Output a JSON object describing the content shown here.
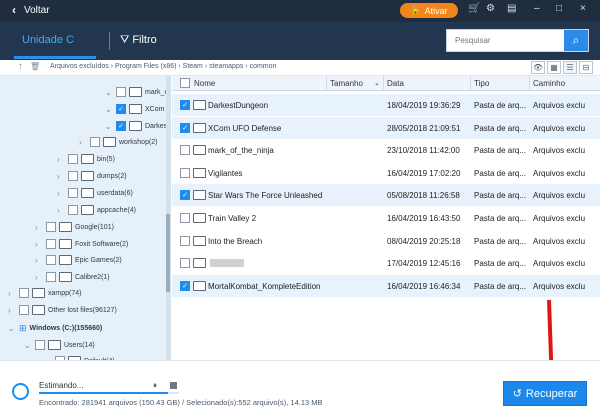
{
  "window": {
    "back_label": "Voltar",
    "activate_label": "Ativar"
  },
  "toolbar": {
    "active_tab": "Unidade C",
    "filter_label": "Filtro",
    "search_placeholder": "Pesquisar"
  },
  "breadcrumb": "Arquivos excluídos  ›  Program Files (x86)  ›  Steam  ›  steamapps  ›  common",
  "tree": [
    {
      "label": "mark_of",
      "checked": false
    },
    {
      "label": "XCom U",
      "checked": true
    },
    {
      "label": "DarkestD",
      "checked": true
    },
    {
      "label": "workshop(2)",
      "checked": false
    },
    {
      "label": "bin(5)",
      "checked": false
    },
    {
      "label": "dumps(2)",
      "checked": false
    },
    {
      "label": "userdata(6)",
      "checked": false
    },
    {
      "label": "appcache(4)",
      "checked": false
    },
    {
      "label": "Google(101)",
      "checked": false
    },
    {
      "label": "Foxit Software(2)",
      "checked": false
    },
    {
      "label": "Epic Games(2)",
      "checked": false
    },
    {
      "label": "Calibre2(1)",
      "checked": false
    },
    {
      "label": "xampp(74)",
      "checked": false
    },
    {
      "label": "Other lost files(96127)",
      "checked": false
    },
    {
      "label": "Windows (C:)(155660)",
      "checked": false
    },
    {
      "label": "Users(14)",
      "checked": false
    },
    {
      "label": "Default(4)",
      "checked": false
    }
  ],
  "table": {
    "columns": [
      "Nome",
      "Tamanho",
      "Data",
      "Tipo",
      "Caminho"
    ],
    "rows": [
      {
        "name": "DarkestDungeon",
        "size": "",
        "date": "18/04/2019 19:36:29",
        "type": "Pasta de arq...",
        "path": "Arquivos exclu",
        "checked": true
      },
      {
        "name": "XCom UFO Defense",
        "size": "",
        "date": "28/05/2018 21:09:51",
        "type": "Pasta de arq...",
        "path": "Arquivos exclu",
        "checked": true
      },
      {
        "name": "mark_of_the_ninja",
        "size": "",
        "date": "23/10/2018 11:42:00",
        "type": "Pasta de arq...",
        "path": "Arquivos exclu",
        "checked": false
      },
      {
        "name": "Vigilantes",
        "size": "",
        "date": "16/04/2019 17:02:20",
        "type": "Pasta de arq...",
        "path": "Arquivos exclu",
        "checked": false
      },
      {
        "name": "Star Wars The Force Unleashed",
        "size": "",
        "date": "05/08/2018 11:26:58",
        "type": "Pasta de arq...",
        "path": "Arquivos exclu",
        "checked": true
      },
      {
        "name": "Train Valley 2",
        "size": "",
        "date": "16/04/2019 16:43:50",
        "type": "Pasta de arq...",
        "path": "Arquivos exclu",
        "checked": false
      },
      {
        "name": "Into the Breach",
        "size": "",
        "date": "08/04/2019 20:25:18",
        "type": "Pasta de arq...",
        "path": "Arquivos exclu",
        "checked": false
      },
      {
        "name": "",
        "size": "",
        "date": "17/04/2019 12:45:16",
        "type": "Pasta de arq...",
        "path": "Arquivos exclu",
        "checked": false
      },
      {
        "name": "MortalKombat_KompleteEdition",
        "size": "",
        "date": "16/04/2019 16:46:34",
        "type": "Pasta de arq...",
        "path": "Arquivos exclu",
        "checked": true
      }
    ]
  },
  "footer": {
    "status": "Estimando...",
    "summary": "Encontrado: 281941 arquivos (150.43 GB) / Selecionado(s):552 arquivo(s), 14.13 MB",
    "recover_label": "Recuperar",
    "progress": 0.92
  },
  "colors": {
    "accent": "#1d88ec",
    "nav_dark": "#22364f",
    "selected_row": "#e7f2fd",
    "arrow": "#e11515"
  }
}
